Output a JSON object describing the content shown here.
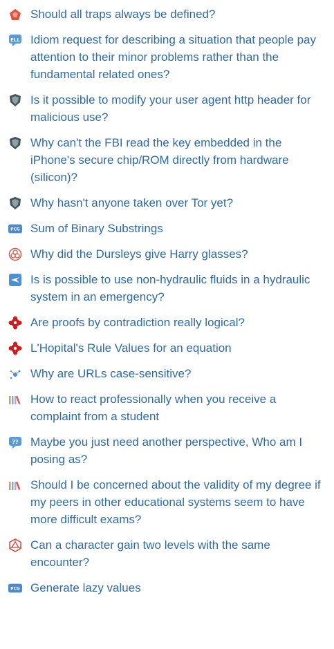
{
  "questions": [
    {
      "title": "Should all traps always be defined?",
      "icon": "rpg-dice-icon"
    },
    {
      "title": "Idiom request for describing a situation that people pay attention to their minor problems rather than the fundamental related ones?",
      "icon": "ell-icon"
    },
    {
      "title": "Is it possible to modify your user agent http header for malicious use?",
      "icon": "security-shield-icon"
    },
    {
      "title": "Why can't the FBI read the key embedded in the iPhone's secure chip/ROM directly from hardware (silicon)?",
      "icon": "security-shield-icon"
    },
    {
      "title": "Why hasn't anyone taken over Tor yet?",
      "icon": "security-shield-icon"
    },
    {
      "title": "Sum of Binary Substrings",
      "icon": "ppcg-icon"
    },
    {
      "title": "Why did the Dursleys give Harry glasses?",
      "icon": "scifi-icon"
    },
    {
      "title": "Is is possible to use non-hydraulic fluids in a hydraulic system in an emergency?",
      "icon": "aviation-icon"
    },
    {
      "title": "Are proofs by contradiction really logical?",
      "icon": "math-icon"
    },
    {
      "title": "L'Hopital's Rule Values for an equation",
      "icon": "math-icon"
    },
    {
      "title": "Why are URLs case-sensitive?",
      "icon": "webmasters-icon"
    },
    {
      "title": "How to react professionally when you receive a complaint from a student",
      "icon": "academia-icon"
    },
    {
      "title": "Maybe you just need another perspective, Who am I posing as?",
      "icon": "puzzling-icon"
    },
    {
      "title": "Should I be concerned about the validity of my degree if my peers in other educational systems seem to have more difficult exams?",
      "icon": "academia-icon"
    },
    {
      "title": "Can a character gain two levels with the same encounter?",
      "icon": "rpg-d20-icon"
    },
    {
      "title": "Generate lazy values",
      "icon": "ppcg-icon"
    }
  ],
  "colors": {
    "link": "#2e6aa8",
    "security": "#45515c",
    "math": "#cf1b1b",
    "ppcg": "#4e8ac9",
    "ell": "#5a9ad6",
    "puzzling": "#5a9ad6",
    "scifi": "#d15a4f",
    "aviation": "#4d8fd0"
  }
}
